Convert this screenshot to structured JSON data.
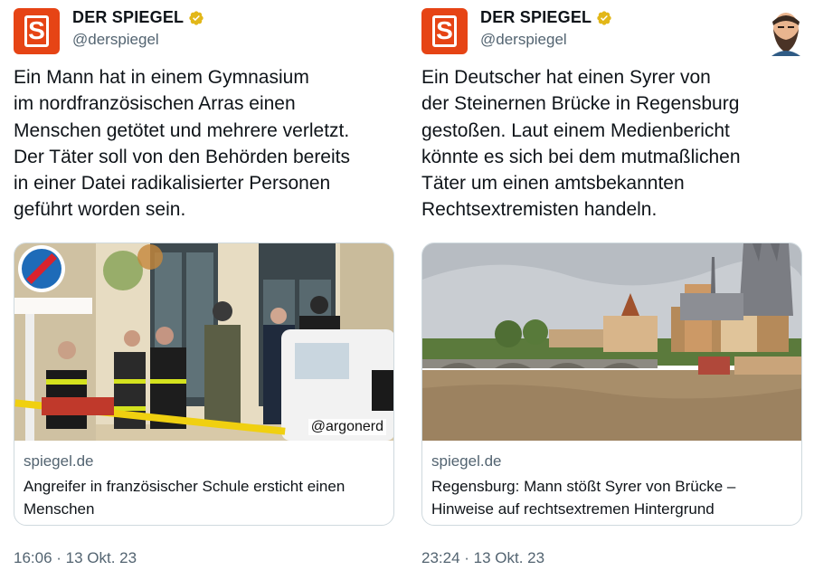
{
  "tweets": [
    {
      "display_name": "DER SPIEGEL",
      "handle": "@derspiegel",
      "logo_letter": "S",
      "text": "Ein Mann hat in einem Gymnasium\nim nordfranzösischen Arras einen\nMenschen getötet und mehrere verletzt.\nDer Täter soll von den Behörden bereits\nin einer Datei radikalisierter Personen\ngeführt worden sein.",
      "card": {
        "domain": "spiegel.de",
        "title": "Angreifer in französischer Schule ersticht einen Menschen",
        "watermark": "@argonerd"
      },
      "timestamp": "16:06 · 13 Okt. 23"
    },
    {
      "display_name": "DER SPIEGEL",
      "handle": "@derspiegel",
      "logo_letter": "S",
      "text": "Ein Deutscher hat einen Syrer von\nder Steinernen Brücke in Regensburg\ngestoßen. Laut einem Medienbericht\nkönnte es sich bei dem mutmaßlichen\nTäter um einen amtsbekannten\nRechtsextremisten handeln.",
      "card": {
        "domain": "spiegel.de",
        "title": "Regensburg: Mann stößt Syrer von Brücke – Hinweise auf rechtsextremen Hintergrund"
      },
      "timestamp": "23:24 · 13 Okt. 23"
    }
  ],
  "colors": {
    "brand": "#e64415",
    "verified": "#e2b719",
    "secondary_text": "#536471",
    "border": "#cfd9de"
  },
  "icons": {
    "verified": "verified-badge-icon",
    "avatar": "bearded-man-avatar"
  }
}
